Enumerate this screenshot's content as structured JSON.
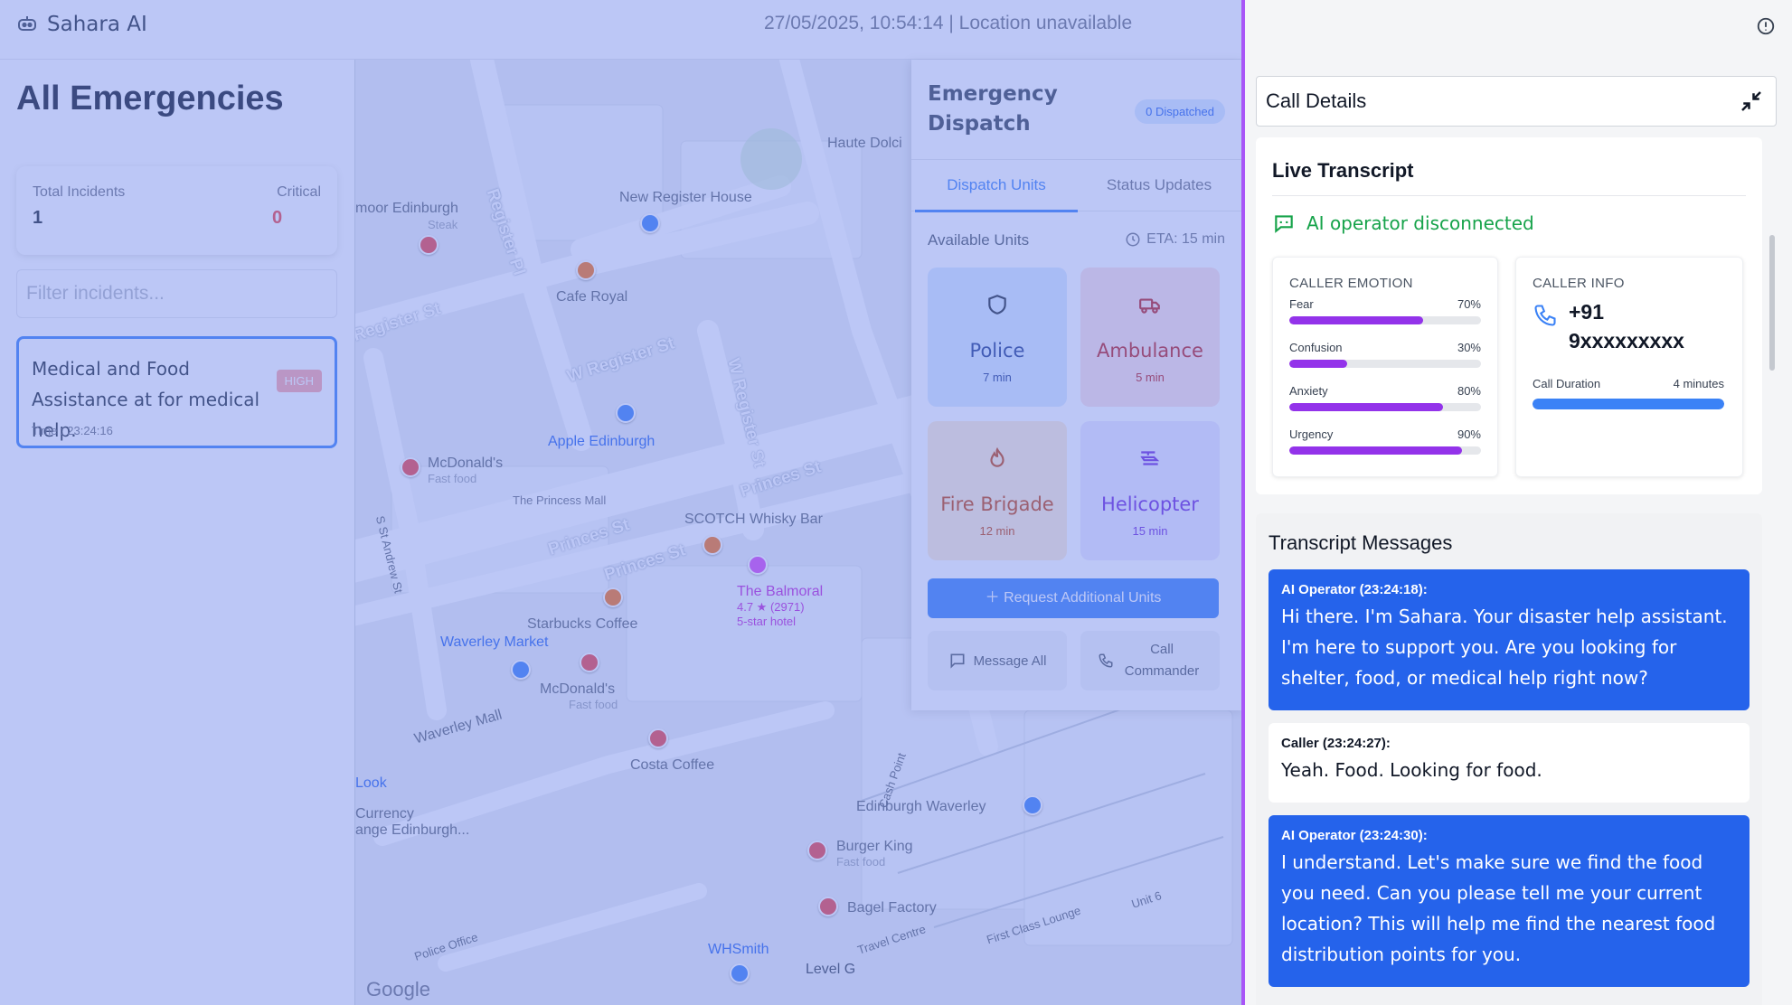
{
  "header": {
    "brand": "Sahara AI",
    "status": "27/05/2025, 10:54:14 | Location unavailable"
  },
  "sidebar": {
    "title": "All Emergencies",
    "stats": {
      "total_label": "Total Incidents",
      "total_value": "1",
      "critical_label": "Critical",
      "critical_value": "0"
    },
    "filter_placeholder": "Filter incidents...",
    "incidents": [
      {
        "title": "Medical and Food Assistance at for medical help.",
        "priority": "HIGH",
        "time": "Time : 23:24:16"
      }
    ]
  },
  "map": {
    "labels": {
      "haute_dolci": "Haute Dolci",
      "new_register_house": "New Register House",
      "cafe_royal": "Cafe Royal",
      "moor_edinburgh": "moor Edinburgh",
      "steak": "Steak",
      "register_pl": "Register Pl",
      "register_st": "Register St",
      "w_register_st": "W Register St",
      "w_register_st2": "W Register St",
      "apple": "Apple Edinburgh",
      "mcdonalds1": "McDonald's",
      "fast_food1": "Fast food",
      "princess_mall": "The Princess Mall",
      "princes_st1": "Princes St",
      "princes_st2": "Princes St",
      "princes_st3": "Princes St",
      "scotch": "SCOTCH Whisky Bar",
      "balmoral": "The Balmoral",
      "balmoral_rating": "4.7 ★ (2971)",
      "balmoral_type": "5-star hotel",
      "starbucks": "Starbucks Coffee",
      "waverley_market": "Waverley Market",
      "mcdonalds2": "McDonald's",
      "fast_food2": "Fast food",
      "waverley_mall": "Waverley Mall",
      "costa": "Costa Coffee",
      "look": "Look",
      "currency": "Currency",
      "currency2": "ange Edinburgh...",
      "edinburgh_waverley": "Edinburgh Waverley",
      "burger_king": "Burger King",
      "fast_food3": "Fast food",
      "bagel": "Bagel Factory",
      "whsmith": "WHSmith",
      "level_g": "Level G",
      "st_andrew": "S St Andrew St",
      "police_office": "Police Office",
      "travel_centre": "Travel Centre",
      "first_class": "First Class Lounge",
      "unit6": "Unit 6",
      "cash_point": "Cash Point",
      "google": "Google"
    }
  },
  "dispatch": {
    "title": "Emergency Dispatch",
    "dispatched_badge": "0  Dispatched",
    "tabs": [
      "Dispatch Units",
      "Status Updates"
    ],
    "available_label": "Available Units",
    "eta": "ETA: 15 min",
    "units": [
      {
        "name": "Police",
        "time": "7 min",
        "icon": "shield-icon",
        "bg": "#dbeafe",
        "color": "#1e3a8a"
      },
      {
        "name": "Ambulance",
        "time": "5 min",
        "icon": "ambulance-icon",
        "bg": "#fee2e2",
        "color": "#b91c1c"
      },
      {
        "name": "Fire Brigade",
        "time": "12 min",
        "icon": "flame-icon",
        "bg": "#ffedd5",
        "color": "#c2410c"
      },
      {
        "name": "Helicopter",
        "time": "15 min",
        "icon": "helicopter-icon",
        "bg": "#ede9fe",
        "color": "#6d28d9"
      }
    ],
    "request_button": "Request Additional Units",
    "message_all": "Message All",
    "call_commander": "Call Commander"
  },
  "call_details": {
    "title": "Call Details",
    "live_title": "Live Transcript",
    "ai_status": "AI operator disconnected",
    "emotion": {
      "heading": "CALLER EMOTION",
      "items": [
        {
          "label": "Fear",
          "percent": "70%",
          "value": 70
        },
        {
          "label": "Confusion",
          "percent": "30%",
          "value": 30
        },
        {
          "label": "Anxiety",
          "percent": "80%",
          "value": 80
        },
        {
          "label": "Urgency",
          "percent": "90%",
          "value": 90
        }
      ]
    },
    "caller_info": {
      "heading": "CALLER INFO",
      "phone": "+91 9xxxxxxxxx",
      "duration_label": "Call Duration",
      "duration_value": "4 minutes",
      "duration_fill": 1.0
    },
    "transcript_title": "Transcript Messages",
    "messages": [
      {
        "role": "ai",
        "who": "AI Operator (23:24:18):",
        "text": "Hi there. I'm Sahara. Your disaster help assistant. I'm here to support you. Are you looking for shelter, food, or medical help right now?"
      },
      {
        "role": "caller",
        "who": "Caller (23:24:27):",
        "text": "Yeah. Food. Looking for food."
      },
      {
        "role": "ai",
        "who": "AI Operator (23:24:30):",
        "text": "I understand. Let's make sure we find the food you need. Can you please tell me your current location? This will help me find the nearest food distribution points for you."
      }
    ]
  },
  "colors": {
    "accent": "#3b82f6",
    "overlay": "#6e86eb",
    "panel_border": "#a855f7",
    "ai_bubble": "#2563eb",
    "emotion_bar": "#9333ea",
    "status_green": "#16a34a"
  }
}
